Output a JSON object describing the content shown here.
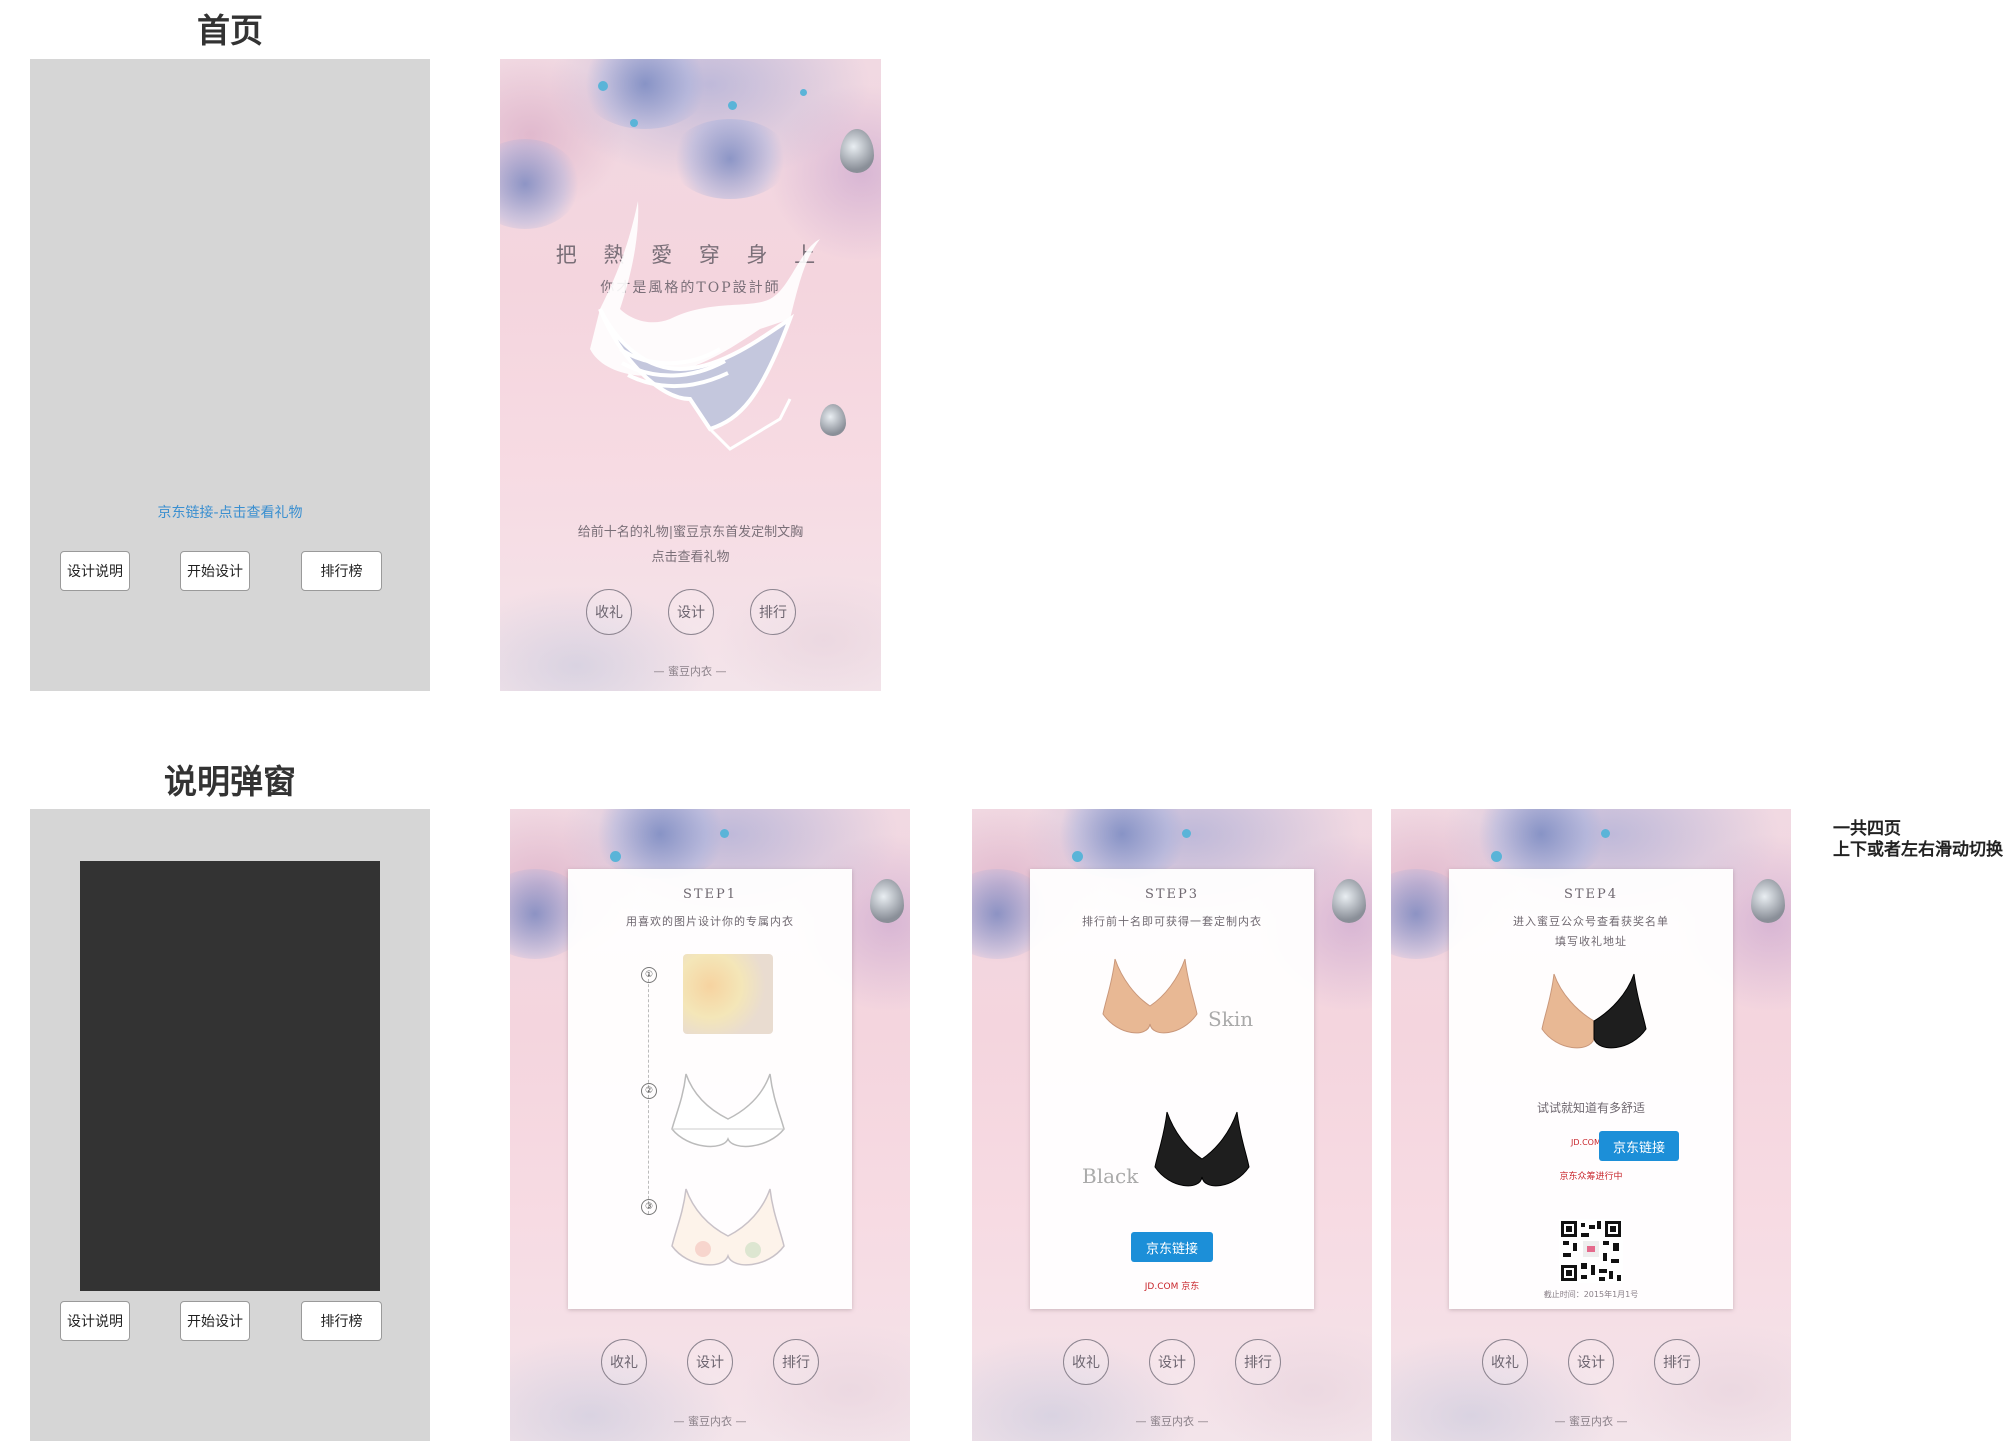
{
  "sections": {
    "home_title": "首页",
    "popup_title": "说明弹窗"
  },
  "wireframe": {
    "jd_link": "京东链接-点击查看礼物",
    "buttons": {
      "design_intro": "设计说明",
      "start_design": "开始设计",
      "ranking": "排行榜"
    }
  },
  "home_mock": {
    "headline": "把 熱 愛 穿 身 上",
    "subheadline": "你才是風格的TOP設計師",
    "gift_line": "给前十名的礼物|蜜豆京东首发定制文胸",
    "cta": "点击查看礼物",
    "nav": {
      "gift": "收礼",
      "design": "设计",
      "rank": "排行"
    },
    "brand": "— 蜜豆内衣 —"
  },
  "steps": {
    "step1": {
      "title": "STEP1",
      "subtitle": "用喜欢的图片设计你的专属内衣",
      "nums": [
        "①",
        "②",
        "③"
      ]
    },
    "step3": {
      "title": "STEP3",
      "subtitle": "排行前十名即可获得一套定制内衣",
      "skin_label": "Skin",
      "black_label": "Black",
      "jd_button": "京东链接",
      "jd_logo": "JD.COM 京东"
    },
    "step4": {
      "title": "STEP4",
      "subtitle_line1": "进入蜜豆公众号查看获奖名单",
      "subtitle_line2": "填写收礼地址",
      "try_line": "试试就知道有多舒适",
      "jd_button": "京东链接",
      "jd_logo": "JD.COM 京东",
      "jd_promo": "京东众筹进行中",
      "deadline": "截止时间：2015年1月1号"
    }
  },
  "note": {
    "line1": "一共四页",
    "line2": "上下或者左右滑动切换"
  }
}
